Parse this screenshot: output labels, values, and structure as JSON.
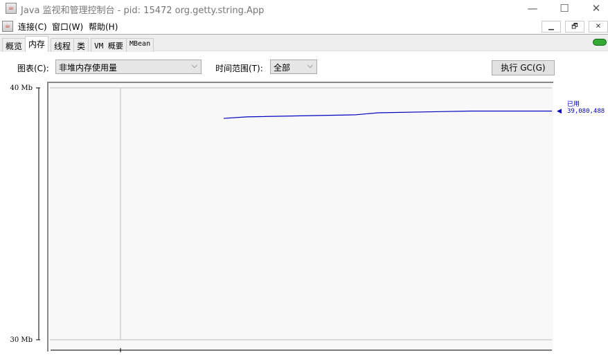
{
  "window": {
    "title": "Java 监视和管理控制台 - pid: 15472 org.getty.string.App",
    "minimize": "—",
    "maximize": "☐",
    "close": "✕"
  },
  "menu": {
    "items": [
      "连接(C)",
      "窗口(W)",
      "帮助(H)"
    ],
    "mdi": [
      "▁",
      "🗗",
      "✕"
    ]
  },
  "tabs": [
    "概览",
    "内存",
    "线程",
    "类",
    "VM 概要",
    "MBean"
  ],
  "active_tab": "内存",
  "controls": {
    "chart_label": "图表(C):",
    "chart_value": "非堆内存使用量",
    "range_label": "时间范围(T):",
    "range_value": "全部",
    "gc_button": "执行 GC(G)"
  },
  "colors": {
    "series": "#0000c0",
    "connected": "#3a3"
  },
  "chart_data": {
    "type": "line",
    "title": "非堆内存使用量",
    "ylabel": "",
    "xlabel": "",
    "ylim": [
      30,
      40
    ],
    "yticks": [
      "30 Mb",
      "40 Mb"
    ],
    "x": [
      0,
      7,
      40,
      47,
      75,
      100
    ],
    "series": [
      {
        "name": "已用",
        "values": [
          38.79,
          38.85,
          38.93,
          39.01,
          39.08,
          39.08
        ],
        "current_label": "39,080,488"
      }
    ],
    "legend": "right"
  }
}
